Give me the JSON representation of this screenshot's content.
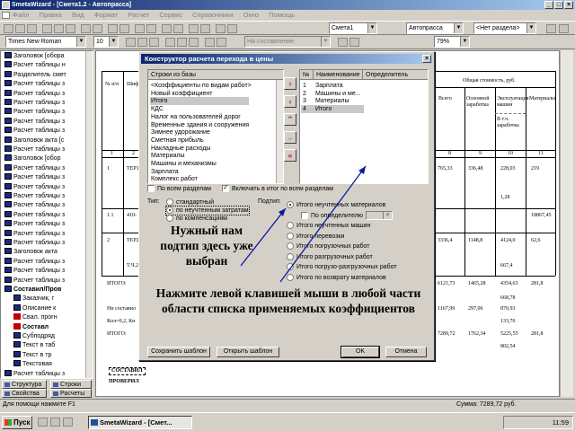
{
  "window": {
    "title": "SmetaWizard - [Смета1.2 - Автопрасса]",
    "buttons": [
      "_",
      "□",
      "×"
    ]
  },
  "menu": [
    "Файл",
    "Правка",
    "Вид",
    "Формат",
    "Расчет",
    "Сервис",
    "Справочники",
    "Окно",
    "Помощь"
  ],
  "toolbar": {
    "font": "Times New Roman",
    "size": "10",
    "style_combo": "На составление",
    "estimate_combo": "Смета1",
    "auto_combo": "Автопрасса",
    "section_combo": "<Нет раздела>",
    "zoom": "79%"
  },
  "tree": [
    {
      "label": "Заголовок [обора",
      "icon": "tbl"
    },
    {
      "label": "Расчет таблицы н",
      "icon": "tbl"
    },
    {
      "label": "Разделитель смет",
      "icon": "tbl"
    },
    {
      "label": "Расчет таблицы з",
      "icon": "tbl"
    },
    {
      "label": "Расчет таблицы з",
      "icon": "tbl"
    },
    {
      "label": "Расчет таблицы з",
      "icon": "tbl"
    },
    {
      "label": "Расчет таблицы з",
      "icon": "tbl"
    },
    {
      "label": "Расчет таблицы з",
      "icon": "tbl"
    },
    {
      "label": "Расчет таблицы з",
      "icon": "tbl"
    },
    {
      "label": "Заголовок акта [с",
      "icon": "tbl"
    },
    {
      "label": "Расчет таблицы з",
      "icon": "tbl"
    },
    {
      "label": "Заголовок [обор",
      "icon": "tbl"
    },
    {
      "label": "Расчет таблицы з",
      "icon": "tbl"
    },
    {
      "label": "Расчет таблицы з",
      "icon": "tbl"
    },
    {
      "label": "Расчет таблицы з",
      "icon": "tbl"
    },
    {
      "label": "Расчет таблицы з",
      "icon": "tbl"
    },
    {
      "label": "Расчет таблицы з",
      "icon": "tbl"
    },
    {
      "label": "Расчет таблицы з",
      "icon": "tbl"
    },
    {
      "label": "Расчет таблицы з",
      "icon": "tbl"
    },
    {
      "label": "Расчет таблицы з",
      "icon": "tbl"
    },
    {
      "label": "Расчет таблицы з",
      "icon": "tbl"
    },
    {
      "label": "Заголовок акта",
      "icon": "tbl"
    },
    {
      "label": "Расчет таблицы з",
      "icon": "tbl"
    },
    {
      "label": "Расчет таблицы з",
      "icon": "tbl"
    },
    {
      "label": "Расчет таблицы з",
      "icon": "tbl"
    },
    {
      "label": "Составил/Пров",
      "icon": "tbl",
      "bold": true
    },
    {
      "label": "Заказчик, г",
      "icon": "tbl",
      "indent": true
    },
    {
      "label": "Описание к",
      "icon": "tbl",
      "indent": true
    },
    {
      "label": "Свал. прогн",
      "icon": "red",
      "indent": true
    },
    {
      "label": "Составл",
      "icon": "red",
      "indent": true,
      "bold": true
    },
    {
      "label": "Субподряд",
      "icon": "tbl",
      "indent": true
    },
    {
      "label": "Текст в таб",
      "icon": "tbl",
      "indent": true
    },
    {
      "label": "Текст в тр",
      "icon": "tbl",
      "indent": true
    },
    {
      "label": "Текстовая",
      "icon": "tbl",
      "indent": true
    },
    {
      "label": "Расчет таблицы з",
      "icon": "tbl"
    }
  ],
  "left_tabs": [
    "Структура",
    "Строки",
    "Свойства",
    "Расчеты"
  ],
  "status": {
    "help": "Для помощи нажмите F1",
    "sum": "Сумма: 7289,72 руб."
  },
  "taskbar": {
    "start": "Пуск",
    "task": "SmetaWizard - [Смет...",
    "clock": "11:59"
  },
  "document": {
    "col_headers": {
      "num": "№ п/п",
      "code": "Шиф",
      "total_cost": "Общая стоимость, руб.",
      "total": "Всего",
      "base_salary": "Основной заработка",
      "machines": "Эксплуатация машин",
      "incl_salary": "В т.ч. заработка",
      "materials": "Материалы"
    },
    "col_numbers": [
      "1",
      "2",
      "8",
      "9",
      "10",
      "11"
    ],
    "rows": [
      {
        "n": "1",
        "code": "ТЕР1 -00",
        "total": "765,33",
        "base": "336,48",
        "mach": "228,03",
        "mat": "219"
      },
      {
        "n": "",
        "code": "",
        "total": "",
        "base": "",
        "mach": "1,28",
        "mat": ""
      },
      {
        "n": "1.1",
        "code": "410-",
        "total": "",
        "base": "",
        "mach": "",
        "mat": "18867,45"
      },
      {
        "n": "2",
        "code": "ТЕР2 -03",
        "total": "3336,4",
        "base": "1148,8",
        "mach": "4124,0",
        "mat": "62,6"
      },
      {
        "n": "",
        "code": "Т.Ч.2 П.",
        "total": "",
        "base": "",
        "mach": "667,4",
        "mat": ""
      }
    ],
    "totals": [
      {
        "label": "ИТОГО:",
        "total": "6121,73",
        "base": "1465,28",
        "mach": "4354,63",
        "mat": "281,8"
      },
      {
        "label": "",
        "total": "",
        "base": "",
        "mach": "668,78",
        "mat": ""
      },
      {
        "label": "Нн составил",
        "total": "1167,99",
        "base": "297,06",
        "mach": "870,93",
        "mat": ""
      },
      {
        "label": "Кпл=0,2, Кн",
        "total": "",
        "base": "",
        "mach": "133,76",
        "mat": ""
      },
      {
        "label": "ИТОГО:",
        "total": "7289,72",
        "base": "1762,34",
        "mach": "5225,55",
        "mat": "281,8"
      },
      {
        "label": "",
        "total": "",
        "base": "",
        "mach": "802,54",
        "mat": ""
      }
    ],
    "footer": [
      "СОСТАВИЛ",
      "ПРОВЕРИЛ"
    ]
  },
  "dialog": {
    "title": "Конструктор расчета перехода в цены",
    "left_list_header": "Строки из базы",
    "left_list": [
      "<Коэффициенты по видам работ>",
      "Новый коэффициент",
      "Итого",
      "КДС",
      "Налог на пользователей дорог",
      "Временные здания и сооружения",
      "Зимнее удорожание",
      "Сметная прибыль",
      "Накладные расходы",
      "Материалы",
      "Машины и механизмы",
      "Зарплата",
      "Комплекс работ"
    ],
    "left_selected_index": 2,
    "right_list_headers": [
      "№",
      "Наименование",
      "Определитель"
    ],
    "right_list": [
      {
        "n": "1",
        "name": "Зарплата"
      },
      {
        "n": "2",
        "name": "Машины и ме..."
      },
      {
        "n": "3",
        "name": "Материалы"
      },
      {
        "n": "4",
        "name": "Итого"
      }
    ],
    "right_selected_index": 3,
    "arrows": [
      {
        "glyph": "›",
        "enabled": true
      },
      {
        "glyph": "‹",
        "enabled": true
      },
      {
        "glyph": "⌃",
        "enabled": true
      },
      {
        "glyph": "⌄",
        "enabled": false
      },
      {
        "glyph": "«",
        "enabled": true
      }
    ],
    "check_all_sections": "По всем разделам",
    "check_include_total": "Включать в итог по всем разделам",
    "type_label": "Тип:",
    "subtype_label": "Подтип:",
    "types": [
      "стандартный",
      "по неучтенным затратам",
      "по компенсациям"
    ],
    "type_selected_index": 1,
    "subtypes": [
      "Итого неучтенных материалов",
      "По определителю",
      "Итого неучтенных машин",
      "Итого перевозки",
      "Итого погрузочных работ",
      "Итого разгрузочных работ",
      "Итого погрузо-разгрузочных работ",
      "Итого по возврату материалов"
    ],
    "subtype_selected_index": 0,
    "buttons": {
      "save": "Сохранить шаблон",
      "open": "Открыть шаблон",
      "ok": "OK",
      "cancel": "Отмена"
    }
  },
  "annotations": {
    "subtype_note": "Нужный нам подтип здесь уже выбран",
    "click_note": "Нажмите левой клавишей мыши в любой части области списка применяемых коэффициентов"
  }
}
